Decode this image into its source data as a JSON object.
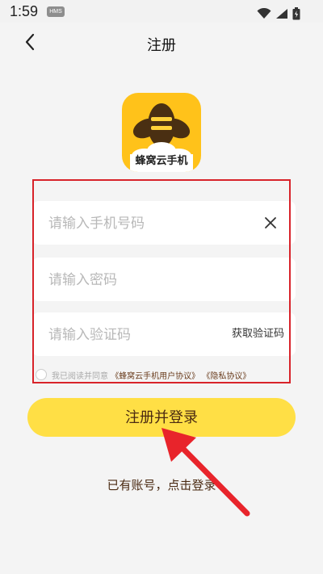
{
  "status_bar": {
    "time": "1:59",
    "badge": "HMS",
    "icons": [
      "wifi-icon",
      "signal-icon",
      "battery-icon"
    ]
  },
  "header": {
    "title": "注册",
    "back_icon": "chevron-left-icon"
  },
  "app": {
    "logo_icon": "bee-logo-icon",
    "name": "蜂窝云手机"
  },
  "form": {
    "phone": {
      "placeholder": "请输入手机号码",
      "value": "",
      "clear_icon": "close-icon"
    },
    "password": {
      "placeholder": "请输入密码",
      "value": ""
    },
    "code": {
      "placeholder": "请输入验证码",
      "value": "",
      "get_code_label": "获取验证码"
    },
    "agreement": {
      "prefix": "我已阅读并同意",
      "user_agreement": "《蜂窝云手机用户协议》",
      "privacy_policy": "《隐私协议》"
    }
  },
  "actions": {
    "register_label": "注册并登录",
    "login_prompt": "已有账号，点击登录"
  },
  "annotation": {
    "frame_color": "#d8232a",
    "arrow_color": "#e8242b"
  },
  "colors": {
    "accent": "#ffdf45",
    "logo_bg": "#ffc21a",
    "text_brown": "#4a2a12",
    "background": "#f4f4f4"
  }
}
